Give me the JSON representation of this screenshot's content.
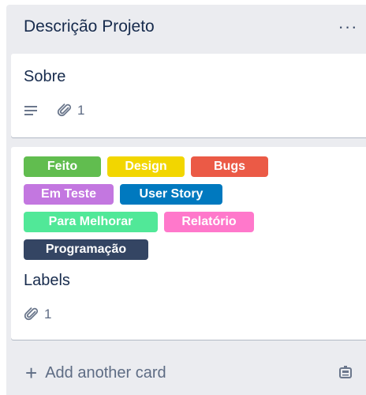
{
  "list": {
    "title": "Descrição Projeto",
    "menu_icon": "more-horizontal-icon",
    "add_card_label": "Add another card",
    "add_card_icon": "plus-icon",
    "template_icon": "card-template-icon"
  },
  "cards": [
    {
      "title": "Sobre",
      "has_description_icon": true,
      "attachments": "1"
    },
    {
      "title": "Labels",
      "attachments": "1",
      "labels": [
        {
          "text": "Feito",
          "color": "#61bd4f"
        },
        {
          "text": "Design",
          "color": "#f2d600"
        },
        {
          "text": "Bugs",
          "color": "#eb5a46"
        },
        {
          "text": "Em Teste",
          "color": "#c377e0"
        },
        {
          "text": "User Story",
          "color": "#0079bf"
        },
        {
          "text": "Para Melhorar",
          "color": "#51e898"
        },
        {
          "text": "Relatório",
          "color": "#ff78cb"
        },
        {
          "text": "Programação",
          "color": "#344563"
        }
      ]
    }
  ]
}
